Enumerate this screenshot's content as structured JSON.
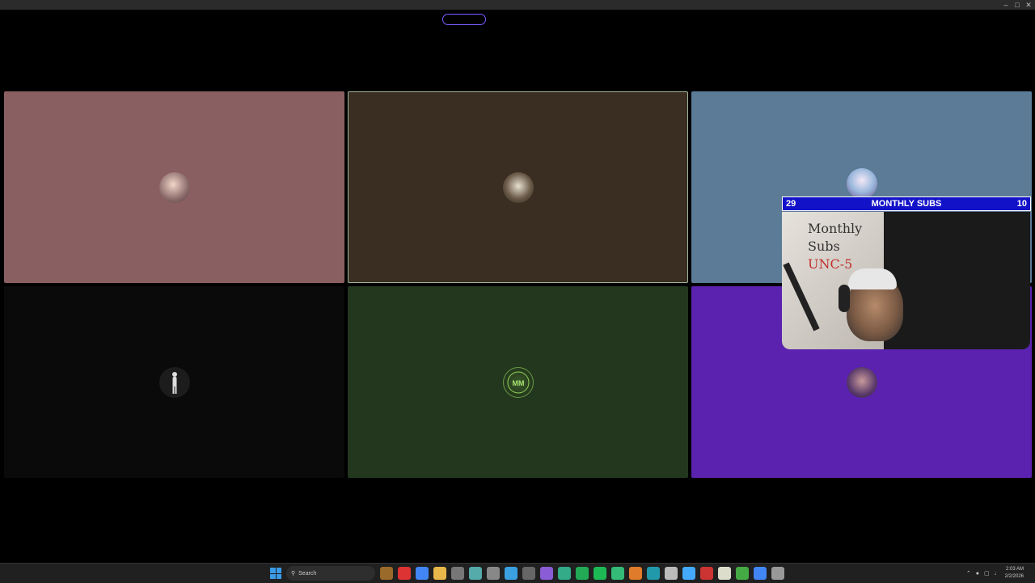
{
  "window": {
    "controls": [
      "–",
      "□",
      "✕"
    ]
  },
  "tiles": [
    {
      "id": "tile-1",
      "color": "#8a5f61",
      "avatar": "avatar-1"
    },
    {
      "id": "tile-2",
      "color": "#3a2e23",
      "avatar": "avatar-2"
    },
    {
      "id": "tile-3",
      "color": "#5b7b97",
      "avatar": "avatar-3"
    },
    {
      "id": "tile-4",
      "color": "#0a0a0a",
      "avatar": "avatar-4"
    },
    {
      "id": "tile-5",
      "color": "#22371e",
      "avatar": "avatar-5"
    },
    {
      "id": "tile-6",
      "color": "#5b22b0",
      "avatar": "avatar-6"
    }
  ],
  "sub_overlay": {
    "left_count": "29",
    "title": "MONTHLY SUBS",
    "right_count": "10"
  },
  "webcam": {
    "whiteboard_line1": "Monthly Subs",
    "whiteboard_line2": "UNC-5"
  },
  "taskbar": {
    "search_placeholder": "Search",
    "time": "2:03 AM",
    "date": "2/2/2026",
    "app_icon_colors": [
      "#9a6a2a",
      "#d33",
      "#4285f4",
      "#e8b84a",
      "#777",
      "#5aa",
      "#888",
      "#3aa0e0",
      "#666",
      "#8a5cd6",
      "#3a8",
      "#2a5",
      "#1db954",
      "#3b7",
      "#e07b2b",
      "#29a",
      "#bbb",
      "#4af",
      "#c33",
      "#ddc",
      "#4a4",
      "#4285f4",
      "#999"
    ]
  }
}
